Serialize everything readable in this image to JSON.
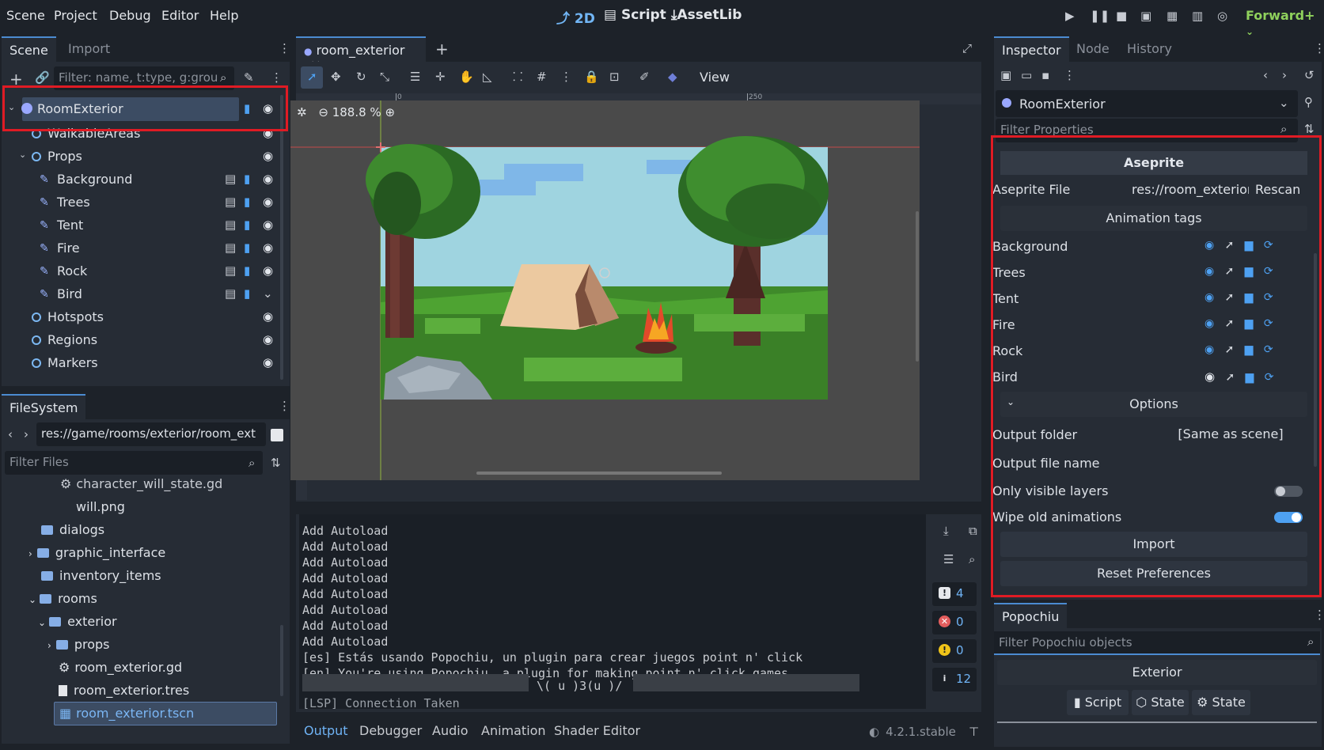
{
  "menu": [
    "Scene",
    "Project",
    "Debug",
    "Editor",
    "Help"
  ],
  "workspaces": {
    "w2d": "2D",
    "script": "Script",
    "assetlib": "AssetLib"
  },
  "renderer": "Forward+",
  "scene_dock": {
    "tabs": [
      "Scene",
      "Import"
    ],
    "filter_placeholder": "Filter: name, t:type, g:grou",
    "nodes": [
      {
        "name": "RoomExterior"
      },
      {
        "name": "WalkableAreas"
      },
      {
        "name": "Props"
      },
      {
        "name": "Background"
      },
      {
        "name": "Trees"
      },
      {
        "name": "Tent"
      },
      {
        "name": "Fire"
      },
      {
        "name": "Rock"
      },
      {
        "name": "Bird"
      },
      {
        "name": "Hotspots"
      },
      {
        "name": "Regions"
      },
      {
        "name": "Markers"
      }
    ]
  },
  "filesystem": {
    "tab": "FileSystem",
    "path": "res://game/rooms/exterior/room_ext",
    "filter_placeholder": "Filter Files",
    "items": [
      {
        "name": "character_will_state.gd",
        "type": "script"
      },
      {
        "name": "will.png",
        "type": "image"
      },
      {
        "name": "dialogs",
        "type": "folder"
      },
      {
        "name": "graphic_interface",
        "type": "folder"
      },
      {
        "name": "inventory_items",
        "type": "folder"
      },
      {
        "name": "rooms",
        "type": "folder"
      },
      {
        "name": "exterior",
        "type": "folder"
      },
      {
        "name": "props",
        "type": "folder"
      },
      {
        "name": "room_exterior.gd",
        "type": "script"
      },
      {
        "name": "room_exterior.tres",
        "type": "file"
      },
      {
        "name": "room_exterior.tscn",
        "type": "scene"
      }
    ]
  },
  "editor": {
    "scene_tab": "room_exterior",
    "view_menu": "View",
    "zoom": "188.8 %",
    "ruler_mark": "250",
    "ruler_zero": "0"
  },
  "output": {
    "lines": [
      "Add Autoload",
      "Add Autoload",
      "Add Autoload",
      "Add Autoload",
      "Add Autoload",
      "Add Autoload",
      "Add Autoload",
      "Add Autoload",
      "[es] Estás usando Popochiu, un plugin para crear juegos point n' click",
      "[en] You're using Popochiu, a plugin for making point n' click games",
      "\\( u )3(u )/",
      "[LSP] Connection Taken"
    ],
    "counters": {
      "messages": "4",
      "errors": "0",
      "warnings": "0",
      "info": "12"
    },
    "tabs": [
      "Output",
      "Debugger",
      "Audio",
      "Animation",
      "Shader Editor"
    ],
    "version": "4.2.1.stable"
  },
  "inspector": {
    "tabs": [
      "Inspector",
      "Node",
      "History"
    ],
    "node_name": "RoomExterior",
    "filter_placeholder": "Filter Properties",
    "section": "Aseprite",
    "aseprite_file_label": "Aseprite File",
    "aseprite_file_value": "res://room_exterior",
    "rescan": "Rescan",
    "animation_tags_label": "Animation tags",
    "tags": [
      "Background",
      "Trees",
      "Tent",
      "Fire",
      "Rock",
      "Bird"
    ],
    "options_label": "Options",
    "output_folder_label": "Output folder",
    "output_folder_value": "[Same as scene]",
    "output_file_name_label": "Output file name",
    "only_visible_layers_label": "Only visible layers",
    "only_visible_layers": false,
    "wipe_old_animations_label": "Wipe old animations",
    "wipe_old_animations": true,
    "import_button": "Import",
    "reset_button": "Reset Preferences"
  },
  "popochiu": {
    "tab": "Popochiu",
    "filter_placeholder": "Filter Popochiu objects",
    "section": "Exterior",
    "buttons": [
      "Script",
      "State",
      "State"
    ]
  }
}
